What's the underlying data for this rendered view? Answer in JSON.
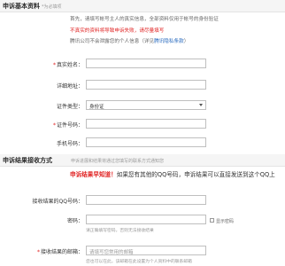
{
  "section1": {
    "title": "申诉基本资料",
    "subtitle": "*为必填项",
    "intro_line1": "首先，请填写帐号主人的真实信息，全部资料仅用于帐号的身份验证",
    "intro_line2": "不真实的资料将导致申诉失败，请尽量填写",
    "intro_line3_prefix": "腾讯公司不会泄露您的个人信息（详见",
    "intro_line3_link": "腾讯隐私条款",
    "intro_line3_suffix": "）",
    "fields": {
      "real_name": {
        "label": "真实姓名：",
        "required": true,
        "value": ""
      },
      "address": {
        "label": "详细地址：",
        "required": false,
        "value": ""
      },
      "id_type": {
        "label": "证件类型：",
        "required": false,
        "value": "身份证"
      },
      "id_number": {
        "label": "证件号码：",
        "required": true,
        "value": ""
      },
      "phone": {
        "label": "手机号码：",
        "required": false,
        "value": ""
      }
    }
  },
  "section2": {
    "title": "申诉结果接收方式",
    "subtitle": "申诉进展和结果将通过您填写的联系方式通知您",
    "notice_bold": "申诉结果早知道！",
    "notice_text": "如果您有其他的QQ号码，申诉结果可以直接发送到这个QQ上",
    "fields": {
      "receive_qq": {
        "label": "接收结果的QQ号码：",
        "value": ""
      },
      "password": {
        "label": "密码：",
        "value": ""
      },
      "show_password_label": "显示密码",
      "password_hint": "请正确填写密码，否则无法接收结果",
      "receive_email": {
        "label": "接收结果的邮箱：",
        "required": true,
        "placeholder": "请填写您常用的邮箱"
      },
      "email_hint": "您也可以在此，该邮箱在此设置为个人资料中的联系邮箱"
    }
  },
  "colors": {
    "required_star": "#e02020",
    "link": "#2a6bbf",
    "section_bg": "#f5f5f5"
  }
}
